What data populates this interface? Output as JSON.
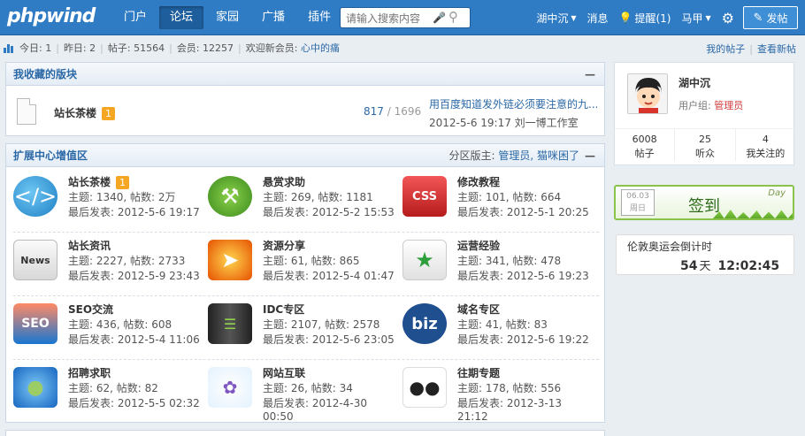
{
  "brand": {
    "logo": "phpwind"
  },
  "nav": {
    "items": [
      "门户",
      "论坛",
      "家园",
      "广播",
      "插件"
    ],
    "active_index": 1
  },
  "search": {
    "placeholder": "请输入搜索内容"
  },
  "user_nav": {
    "username": "湖中沉",
    "messages": "消息",
    "remind": "提醒(1)",
    "horse": "马甲",
    "post_button": "发帖"
  },
  "stats": {
    "today_label": "今日:",
    "today": "1",
    "yesterday_label": "昨日:",
    "yesterday": "2",
    "posts_label": "帖子:",
    "posts": "51564",
    "members_label": "会员:",
    "members": "12257",
    "welcome_label": "欢迎新会员:",
    "new_member": "心中的痛",
    "my_posts": "我的帖子",
    "new_posts": "查看新帖"
  },
  "fav": {
    "title": "我收藏的版块",
    "name": "站长茶楼",
    "badge": "1",
    "num_a": "817",
    "num_sep": "/",
    "num_b": "1696",
    "last_title": "用百度知道发外链必须要注意的九...",
    "last_time": "2012-5-6 19:17 刘一博工作室"
  },
  "ext": {
    "title": "扩展中心增值区",
    "moderator_label": "分区版主:",
    "moderators": "管理员, 猫咪困了",
    "forums": [
      {
        "name": "站长茶楼",
        "badge": "1",
        "stats": "主题: 1340, 帖数: 2万",
        "last": "最后发表: 2012-5-6 19:17",
        "icon": "chat-bubble-icon"
      },
      {
        "name": "悬赏求助",
        "stats": "主题: 269, 帖数: 1181",
        "last": "最后发表: 2012-5-2 15:53",
        "icon": "helper-icon"
      },
      {
        "name": "修改教程",
        "stats": "主题: 101, 帖数: 664",
        "last": "最后发表: 2012-5-1 20:25",
        "icon": "css-folder-icon"
      },
      {
        "name": "站长资讯",
        "stats": "主题: 2227, 帖数: 2733",
        "last": "最后发表: 2012-5-9 23:43",
        "icon": "newspaper-icon"
      },
      {
        "name": "资源分享",
        "stats": "主题: 61, 帖数: 865",
        "last": "最后发表: 2012-5-4 01:47",
        "icon": "rocket-icon"
      },
      {
        "name": "运营经验",
        "stats": "主题: 341, 帖数: 478",
        "last": "最后发表: 2012-5-6 19:23",
        "icon": "growth-chart-icon"
      },
      {
        "name": "SEO交流",
        "stats": "主题: 436, 帖数: 608",
        "last": "最后发表: 2012-5-4 11:06",
        "icon": "seo-icon"
      },
      {
        "name": "IDC专区",
        "stats": "主题: 2107, 帖数: 2578",
        "last": "最后发表: 2012-5-6 23:05",
        "icon": "server-icon"
      },
      {
        "name": "域名专区",
        "stats": "主题: 41, 帖数: 83",
        "last": "最后发表: 2012-5-6 19:22",
        "icon": "biz-icon"
      },
      {
        "name": "招聘求职",
        "stats": "主题: 62, 帖数: 82",
        "last": "最后发表: 2012-5-5 02:32",
        "icon": "people-icon"
      },
      {
        "name": "网站互联",
        "stats": "主题: 26, 帖数: 34",
        "last": "最后发表: 2012-4-30 00:50",
        "icon": "network-icon"
      },
      {
        "name": "往期专题",
        "stats": "主题: 178, 帖数: 556",
        "last": "最后发表: 2012-3-13 21:12",
        "icon": "focus-icon"
      }
    ]
  },
  "profile": {
    "name": "湖中沉",
    "group_label": "用户组:",
    "group": "管理员",
    "posts": "6008",
    "posts_label": "帖子",
    "fans": "25",
    "fans_label": "听众",
    "follow": "4",
    "follow_label": "我关注的"
  },
  "checkin": {
    "date": "06.03",
    "weekday": "周日",
    "label": "签到",
    "day": "Day"
  },
  "countdown": {
    "title": "伦敦奥运会倒计时",
    "days": "54",
    "day_unit": "天",
    "time": "12:02:45"
  },
  "colors": {
    "top_bar": "#2f7bc4",
    "link": "#2b68a6",
    "badge": "#f5a623",
    "admin": "#d23c3c"
  }
}
